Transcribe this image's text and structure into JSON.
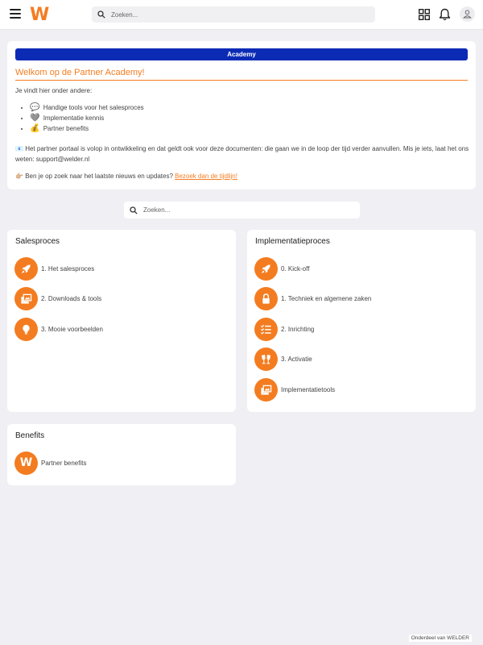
{
  "header": {
    "logo_letter": "W",
    "search_placeholder": "Zoeken..."
  },
  "welcome": {
    "banner": "Academy",
    "title": "Welkom op de Partner Academy!",
    "intro": "Je vindt hier onder andere:",
    "bullets": [
      {
        "emoji": "💬",
        "text": "Handige tools voor het salesproces"
      },
      {
        "emoji": "🩶",
        "text": "Implementatie kennis"
      },
      {
        "emoji": "💰",
        "text": "Partner benefits"
      }
    ],
    "notice_emoji": "📧",
    "notice": "Het partner portaal is volop in ontwikkeling en dat geldt ook voor deze documenten: die gaan we in de loop der tijd verder aanvullen. Mis je iets, laat het ons weten: support@welder.nl",
    "news_emoji": "👉🏼",
    "news_text": "Ben je op zoek naar het laatste nieuws en updates?",
    "news_link": "Bezoek dan de tijdlijn!"
  },
  "content_search": {
    "placeholder": "Zoeken..."
  },
  "sections": {
    "sales": {
      "title": "Salesproces",
      "items": [
        {
          "label": "1. Het salesproces",
          "icon": "rocket-icon"
        },
        {
          "label": "2. Downloads & tools",
          "icon": "downloads-icon"
        },
        {
          "label": "3. Mooie voorbeelden",
          "icon": "lightbulb-icon"
        }
      ]
    },
    "impl": {
      "title": "Implementatieproces",
      "items": [
        {
          "label": "0. Kick-off",
          "icon": "rocket-icon"
        },
        {
          "label": "1. Techniek en algemene zaken",
          "icon": "lock-icon"
        },
        {
          "label": "2. Inrichting",
          "icon": "checklist-icon"
        },
        {
          "label": "3. Activatie",
          "icon": "cheers-icon"
        },
        {
          "label": "Implementatietools",
          "icon": "downloads-icon"
        }
      ]
    },
    "benefits": {
      "title": "Benefits",
      "items": [
        {
          "label": "Partner benefits",
          "icon": "welder-logo-icon",
          "letter": "W"
        }
      ]
    }
  },
  "footer": {
    "text": "Onderdeel van WELDER"
  },
  "colors": {
    "accent": "#f47c20",
    "banner": "#0b2bb5",
    "background": "#efeff4"
  }
}
